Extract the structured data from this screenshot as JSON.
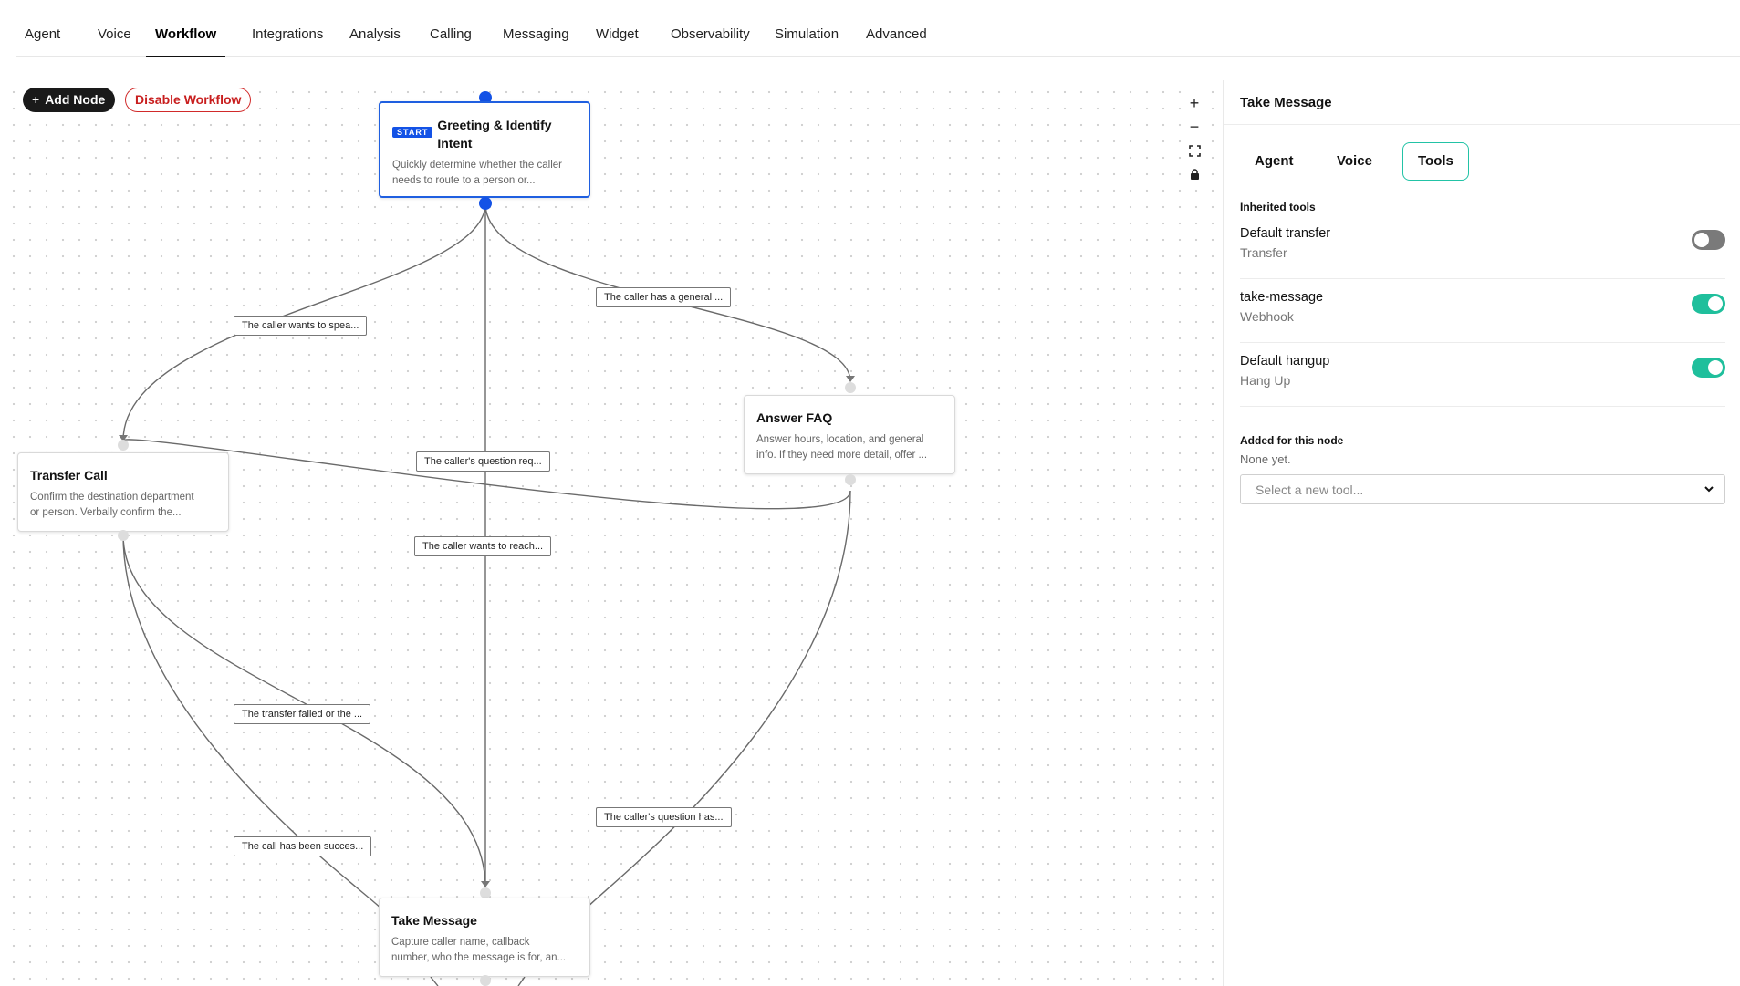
{
  "nav": {
    "tabs": [
      {
        "label": "Agent"
      },
      {
        "label": "Voice"
      },
      {
        "label": "Workflow",
        "active": true
      },
      {
        "label": "Integrations"
      },
      {
        "label": "Analysis"
      },
      {
        "label": "Calling"
      },
      {
        "label": "Messaging"
      },
      {
        "label": "Widget"
      },
      {
        "label": "Observability"
      },
      {
        "label": "Simulation"
      },
      {
        "label": "Advanced"
      }
    ]
  },
  "toolbar": {
    "add_node_label": "Add Node",
    "add_node_icon": "plus-icon",
    "disable_workflow_label": "Disable Workflow"
  },
  "zoom_controls": {
    "icons": [
      "zoom-in-icon",
      "zoom-out-icon",
      "fit-view-icon",
      "lock-icon"
    ]
  },
  "nodes": {
    "greeting": {
      "badge": "START",
      "title": "Greeting & Identify Intent",
      "desc_line1": "Quickly determine whether the caller",
      "desc_line2": "needs to route to a person or..."
    },
    "answer_faq": {
      "title": "Answer FAQ",
      "desc_line1": "Answer hours, location, and general",
      "desc_line2": "info. If they need more detail, offer ..."
    },
    "transfer_call": {
      "title": "Transfer Call",
      "desc_line1": "Confirm the destination department",
      "desc_line2": "or person. Verbally confirm the..."
    },
    "take_message": {
      "title": "Take Message",
      "desc_line1": "Capture caller name, callback",
      "desc_line2": "number, who the message is for, an..."
    }
  },
  "edge_labels": {
    "general": "The caller has a general ...",
    "speak": "The caller wants to spea...",
    "question_req": "The caller's question req...",
    "reach": "The caller wants to reach...",
    "transfer_failed": "The transfer failed or the ...",
    "call_success": "The call has been succes...",
    "question_has": "The caller's question has..."
  },
  "panel": {
    "title": "Take Message",
    "tabs": [
      {
        "label": "Agent"
      },
      {
        "label": "Voice"
      },
      {
        "label": "Tools",
        "active": true
      }
    ],
    "inherited_label": "Inherited tools",
    "inherited_tools": [
      {
        "name": "Default transfer",
        "type": "Transfer",
        "enabled": false
      },
      {
        "name": "take-message",
        "type": "Webhook",
        "enabled": true
      },
      {
        "name": "Default hangup",
        "type": "Hang Up",
        "enabled": true
      }
    ],
    "added_label": "Added for this node",
    "added_empty": "None yet.",
    "select_placeholder": "Select a new tool..."
  },
  "colors": {
    "accent_blue": "#1352e6",
    "toggle_on": "#1fbf9c",
    "toggle_off": "#7a7a7a",
    "danger": "#c81e1e",
    "active_tab_border": "#22c3a6"
  }
}
